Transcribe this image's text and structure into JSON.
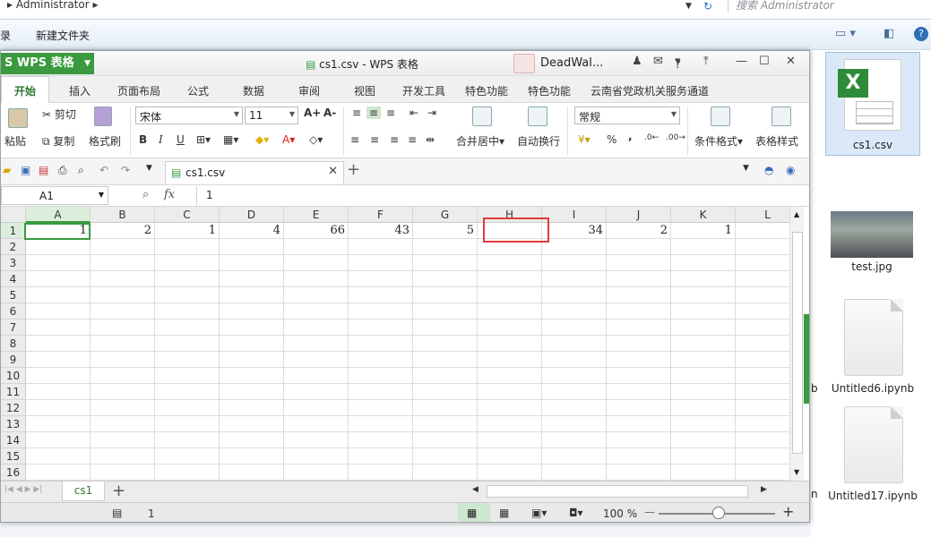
{
  "explorer": {
    "address": "Administrator",
    "search_placeholder": "搜索 Administrator",
    "toolbar_left_fragment": "录",
    "new_folder": "新建文件夹",
    "files": [
      {
        "name": "cs1.csv",
        "type": "excel"
      },
      {
        "name": "test.jpg",
        "type": "image"
      },
      {
        "name": "Untitled6.ipynb",
        "type": "doc"
      },
      {
        "name": "Untitled17.ipynb",
        "type": "doc"
      }
    ],
    "clipped_labels": [
      "b",
      "n"
    ]
  },
  "wps": {
    "app_button": "WPS 表格",
    "window_title": "cs1.csv - WPS 表格",
    "user_name": "DeadWal...",
    "help": "?",
    "menu_tabs": [
      "开始",
      "插入",
      "页面布局",
      "公式",
      "数据",
      "审阅",
      "视图",
      "开发工具",
      "特色功能",
      "特色功能",
      "云南省党政机关服务通道"
    ],
    "ribbon": {
      "paste": "粘贴",
      "cut": "剪切",
      "copy": "复制",
      "format_painter": "格式刷",
      "font_name": "宋体",
      "font_size": "11",
      "bold": "B",
      "italic": "I",
      "underline": "U",
      "font_grow": "A+",
      "font_shrink": "A-",
      "merge_center": "合并居中",
      "wrap_text": "自动换行",
      "number_format": "常规",
      "percent": "%",
      "comma": ",",
      "conditional_format": "条件格式",
      "table_style": "表格样式"
    },
    "document_tab": "cs1.csv",
    "name_box": "A1",
    "fx_label": "fx",
    "formula_value": "1",
    "columns": [
      "A",
      "B",
      "C",
      "D",
      "E",
      "F",
      "G",
      "H",
      "I",
      "J",
      "K",
      "L"
    ],
    "rows": [
      "1",
      "2",
      "3",
      "4",
      "5",
      "6",
      "7",
      "8",
      "9",
      "10",
      "11",
      "12",
      "13",
      "14",
      "15",
      "16"
    ],
    "row1_values": [
      "1",
      "2",
      "1",
      "4",
      "66",
      "43",
      "5",
      "",
      "34",
      "2",
      "1",
      ""
    ],
    "sheet_tab": "cs1",
    "status_value": "1",
    "zoom": "100 %",
    "zoom_plus": "+",
    "zoom_minus": "—"
  }
}
